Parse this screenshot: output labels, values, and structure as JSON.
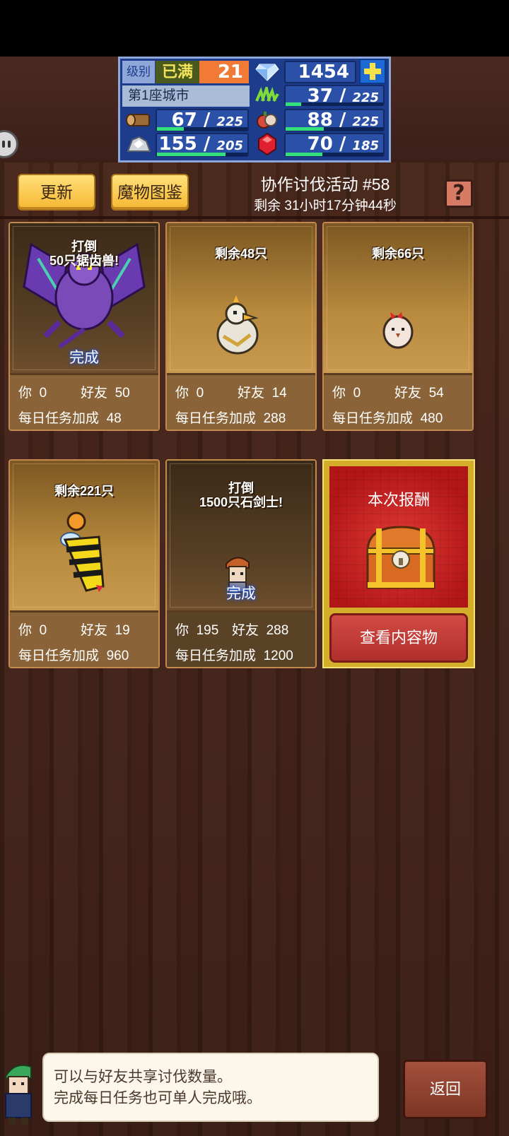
{
  "resources": {
    "level_label": "级别",
    "level_status": "已满",
    "level_value": "21",
    "gems": "1454",
    "city_name": "第1座城市",
    "grass": "37",
    "grass_max": "225",
    "wood": "67",
    "wood_max": "225",
    "food": "88",
    "food_max": "225",
    "ore": "155",
    "ore_max": "205",
    "ruby": "70",
    "ruby_max": "185",
    "bar_fill": {
      "grass": 0.16,
      "wood": 0.3,
      "food": 0.39,
      "ore": 0.76,
      "ruby": 0.38
    }
  },
  "header": {
    "refresh_label": "更新",
    "bestiary_label": "魔物图鉴",
    "event_title": "协作讨伐活动 #58",
    "remaining_time": "剩余 31小时17分钟44秒",
    "help_label": "?"
  },
  "cards": [
    {
      "title_line1": "打倒",
      "title_line2": "50只锯齿兽!",
      "status": "完成",
      "you_label": "你",
      "you": "0",
      "friend_label": "好友",
      "friend": "50",
      "bonus_label": "每日任务加成",
      "bonus": "48"
    },
    {
      "title_line1": "剩余48只",
      "title_line2": "",
      "status": "",
      "you_label": "你",
      "you": "0",
      "friend_label": "好友",
      "friend": "14",
      "bonus_label": "每日任务加成",
      "bonus": "288"
    },
    {
      "title_line1": "剩余66只",
      "title_line2": "",
      "status": "",
      "you_label": "你",
      "you": "0",
      "friend_label": "好友",
      "friend": "54",
      "bonus_label": "每日任务加成",
      "bonus": "480"
    },
    {
      "title_line1": "剩余221只",
      "title_line2": "",
      "status": "",
      "you_label": "你",
      "you": "0",
      "friend_label": "好友",
      "friend": "19",
      "bonus_label": "每日任务加成",
      "bonus": "960"
    },
    {
      "title_line1": "打倒",
      "title_line2": "1500只石剑士!",
      "status": "完成",
      "you_label": "你",
      "you": "195",
      "friend_label": "好友",
      "friend": "288",
      "bonus_label": "每日任务加成",
      "bonus": "1200"
    }
  ],
  "reward": {
    "title": "本次报酬",
    "button_label": "查看内容物"
  },
  "tip": {
    "line1": "可以与好友共享讨伐数量。",
    "line2": "完成每日任务也可单人完成哦。"
  },
  "back_label": "返回",
  "colors": {
    "accent_gold": "#f6b732",
    "panel_blue": "#1d3c8c",
    "bar_green": "#33e07a",
    "reward_red": "#c8201e"
  }
}
